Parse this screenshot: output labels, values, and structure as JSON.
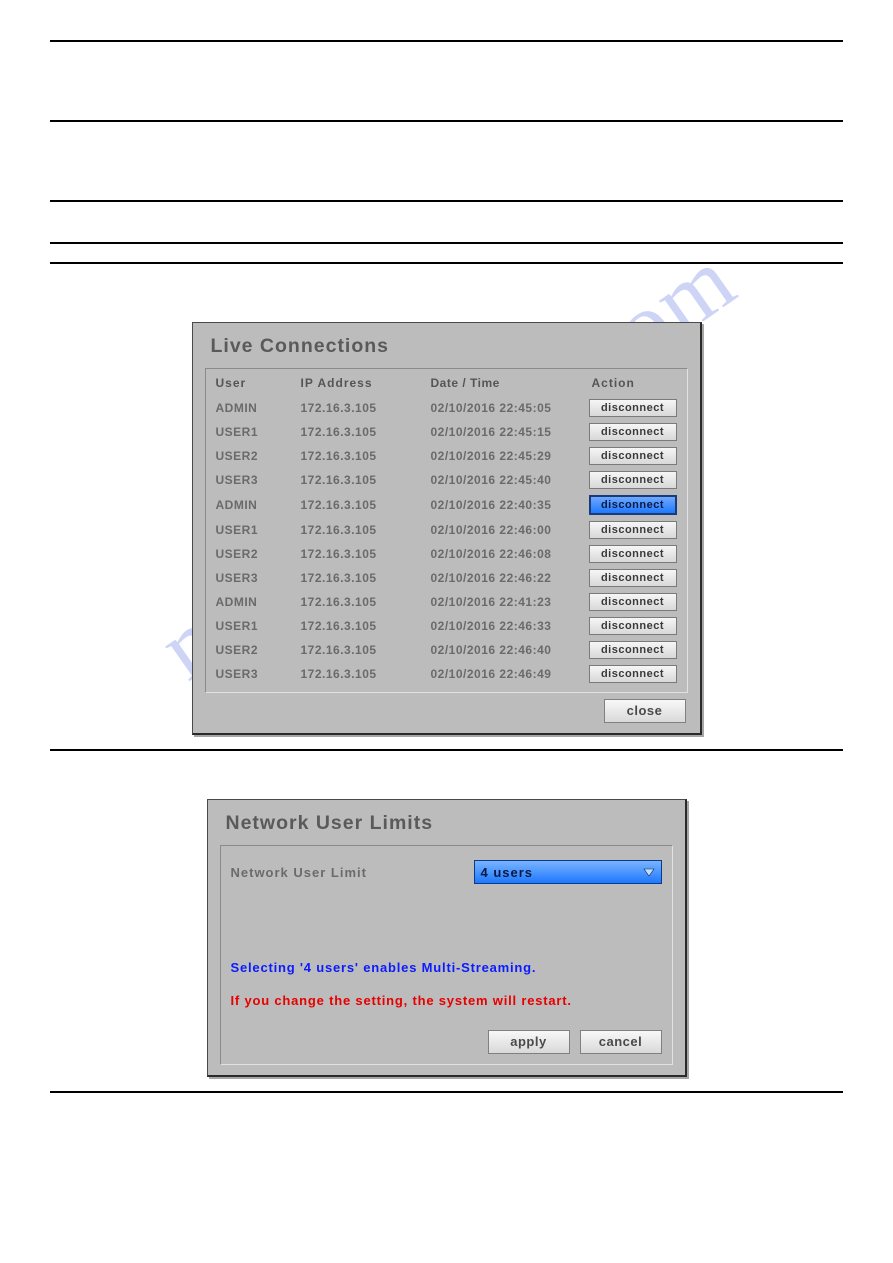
{
  "watermark": "manualshive.com",
  "live_connections": {
    "title": "Live Connections",
    "headers": {
      "user": "User",
      "ip": "IP Address",
      "dt": "Date / Time",
      "action": "Action"
    },
    "disconnect_label": "disconnect",
    "close_label": "close",
    "rows": [
      {
        "user": "ADMIN",
        "ip": "172.16.3.105",
        "dt": "02/10/2016 22:45:05",
        "selected": false
      },
      {
        "user": "USER1",
        "ip": "172.16.3.105",
        "dt": "02/10/2016 22:45:15",
        "selected": false
      },
      {
        "user": "USER2",
        "ip": "172.16.3.105",
        "dt": "02/10/2016 22:45:29",
        "selected": false
      },
      {
        "user": "USER3",
        "ip": "172.16.3.105",
        "dt": "02/10/2016 22:45:40",
        "selected": false
      },
      {
        "user": "ADMIN",
        "ip": "172.16.3.105",
        "dt": "02/10/2016 22:40:35",
        "selected": true
      },
      {
        "user": "USER1",
        "ip": "172.16.3.105",
        "dt": "02/10/2016 22:46:00",
        "selected": false
      },
      {
        "user": "USER2",
        "ip": "172.16.3.105",
        "dt": "02/10/2016 22:46:08",
        "selected": false
      },
      {
        "user": "USER3",
        "ip": "172.16.3.105",
        "dt": "02/10/2016 22:46:22",
        "selected": false
      },
      {
        "user": "ADMIN",
        "ip": "172.16.3.105",
        "dt": "02/10/2016 22:41:23",
        "selected": false
      },
      {
        "user": "USER1",
        "ip": "172.16.3.105",
        "dt": "02/10/2016 22:46:33",
        "selected": false
      },
      {
        "user": "USER2",
        "ip": "172.16.3.105",
        "dt": "02/10/2016 22:46:40",
        "selected": false
      },
      {
        "user": "USER3",
        "ip": "172.16.3.105",
        "dt": "02/10/2016 22:46:49",
        "selected": false
      }
    ]
  },
  "network_user_limits": {
    "title": "Network User Limits",
    "label": "Network User Limit",
    "value": "4 users",
    "note_multi": "Selecting '4 users' enables Multi-Streaming.",
    "note_restart": "If you change the setting, the system will restart.",
    "apply_label": "apply",
    "cancel_label": "cancel"
  }
}
